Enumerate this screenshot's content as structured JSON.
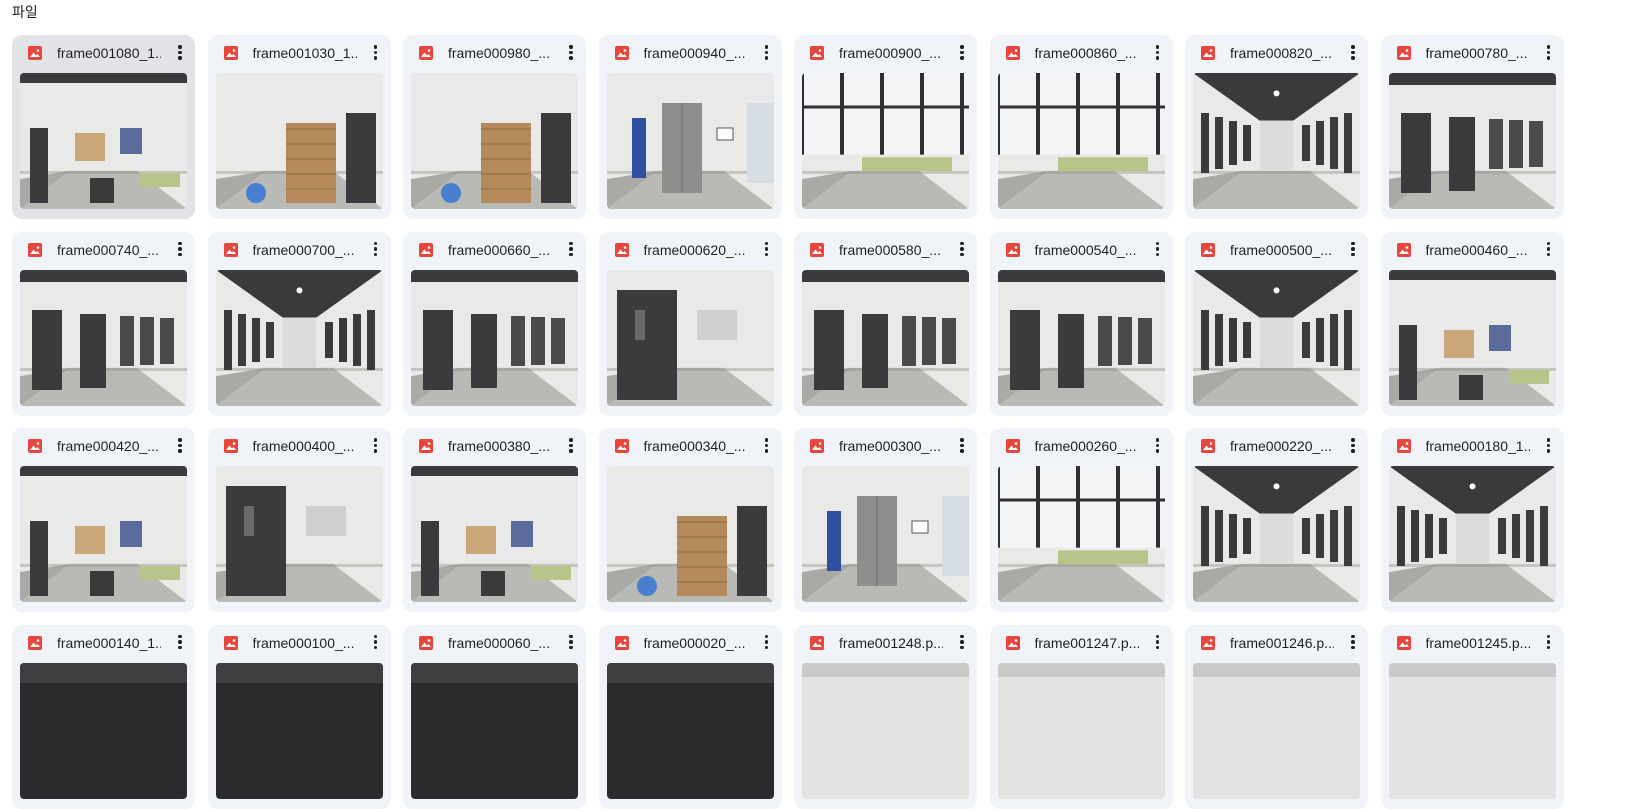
{
  "section": {
    "label": "파일"
  },
  "colors": {
    "card_bg": "#f0f4f9",
    "card_selected_bg": "#e1e3e6",
    "image_icon": "#e8453c"
  },
  "files": [
    {
      "name": "frame001080_1...",
      "selected": true,
      "scene": "lounge",
      "icon": "image-file-icon",
      "menu_icon": "more-vert-icon"
    },
    {
      "name": "frame001030_1...",
      "selected": false,
      "scene": "cabinet",
      "icon": "image-file-icon",
      "menu_icon": "more-vert-icon"
    },
    {
      "name": "frame000980_...",
      "selected": false,
      "scene": "cabinet",
      "icon": "image-file-icon",
      "menu_icon": "more-vert-icon"
    },
    {
      "name": "frame000940_...",
      "selected": false,
      "scene": "elevator",
      "icon": "image-file-icon",
      "menu_icon": "more-vert-icon"
    },
    {
      "name": "frame000900_...",
      "selected": false,
      "scene": "window",
      "icon": "image-file-icon",
      "menu_icon": "more-vert-icon"
    },
    {
      "name": "frame000860_...",
      "selected": false,
      "scene": "window",
      "icon": "image-file-icon",
      "menu_icon": "more-vert-icon"
    },
    {
      "name": "frame000820_...",
      "selected": false,
      "scene": "corridor",
      "icon": "image-file-icon",
      "menu_icon": "more-vert-icon"
    },
    {
      "name": "frame000780_...",
      "selected": false,
      "scene": "doors",
      "icon": "image-file-icon",
      "menu_icon": "more-vert-icon"
    },
    {
      "name": "frame000740_...",
      "selected": false,
      "scene": "doors",
      "icon": "image-file-icon",
      "menu_icon": "more-vert-icon"
    },
    {
      "name": "frame000700_...",
      "selected": false,
      "scene": "corridor",
      "icon": "image-file-icon",
      "menu_icon": "more-vert-icon"
    },
    {
      "name": "frame000660_...",
      "selected": false,
      "scene": "doors",
      "icon": "image-file-icon",
      "menu_icon": "more-vert-icon"
    },
    {
      "name": "frame000620_...",
      "selected": false,
      "scene": "door-close",
      "icon": "image-file-icon",
      "menu_icon": "more-vert-icon"
    },
    {
      "name": "frame000580_...",
      "selected": false,
      "scene": "doors",
      "icon": "image-file-icon",
      "menu_icon": "more-vert-icon"
    },
    {
      "name": "frame000540_...",
      "selected": false,
      "scene": "doors",
      "icon": "image-file-icon",
      "menu_icon": "more-vert-icon"
    },
    {
      "name": "frame000500_...",
      "selected": false,
      "scene": "corridor",
      "icon": "image-file-icon",
      "menu_icon": "more-vert-icon"
    },
    {
      "name": "frame000460_...",
      "selected": false,
      "scene": "lounge",
      "icon": "image-file-icon",
      "menu_icon": "more-vert-icon"
    },
    {
      "name": "frame000420_...",
      "selected": false,
      "scene": "lounge",
      "icon": "image-file-icon",
      "menu_icon": "more-vert-icon"
    },
    {
      "name": "frame000400_...",
      "selected": false,
      "scene": "door-close",
      "icon": "image-file-icon",
      "menu_icon": "more-vert-icon"
    },
    {
      "name": "frame000380_...",
      "selected": false,
      "scene": "lounge",
      "icon": "image-file-icon",
      "menu_icon": "more-vert-icon"
    },
    {
      "name": "frame000340_...",
      "selected": false,
      "scene": "cabinet",
      "icon": "image-file-icon",
      "menu_icon": "more-vert-icon"
    },
    {
      "name": "frame000300_...",
      "selected": false,
      "scene": "elevator",
      "icon": "image-file-icon",
      "menu_icon": "more-vert-icon"
    },
    {
      "name": "frame000260_...",
      "selected": false,
      "scene": "window",
      "icon": "image-file-icon",
      "menu_icon": "more-vert-icon"
    },
    {
      "name": "frame000220_...",
      "selected": false,
      "scene": "corridor",
      "icon": "image-file-icon",
      "menu_icon": "more-vert-icon"
    },
    {
      "name": "frame000180_1...",
      "selected": false,
      "scene": "corridor",
      "icon": "image-file-icon",
      "menu_icon": "more-vert-icon"
    },
    {
      "name": "frame000140_1...",
      "selected": false,
      "scene": "dark",
      "icon": "image-file-icon",
      "menu_icon": "more-vert-icon"
    },
    {
      "name": "frame000100_...",
      "selected": false,
      "scene": "dark",
      "icon": "image-file-icon",
      "menu_icon": "more-vert-icon"
    },
    {
      "name": "frame000060_...",
      "selected": false,
      "scene": "dark",
      "icon": "image-file-icon",
      "menu_icon": "more-vert-icon"
    },
    {
      "name": "frame000020_...",
      "selected": false,
      "scene": "dark",
      "icon": "image-file-icon",
      "menu_icon": "more-vert-icon"
    },
    {
      "name": "frame001248.p...",
      "selected": false,
      "scene": "light",
      "icon": "image-file-icon",
      "menu_icon": "more-vert-icon"
    },
    {
      "name": "frame001247.p...",
      "selected": false,
      "scene": "light",
      "icon": "image-file-icon",
      "menu_icon": "more-vert-icon"
    },
    {
      "name": "frame001246.p...",
      "selected": false,
      "scene": "light",
      "icon": "image-file-icon",
      "menu_icon": "more-vert-icon"
    },
    {
      "name": "frame001245.p...",
      "selected": false,
      "scene": "light",
      "icon": "image-file-icon",
      "menu_icon": "more-vert-icon"
    }
  ]
}
